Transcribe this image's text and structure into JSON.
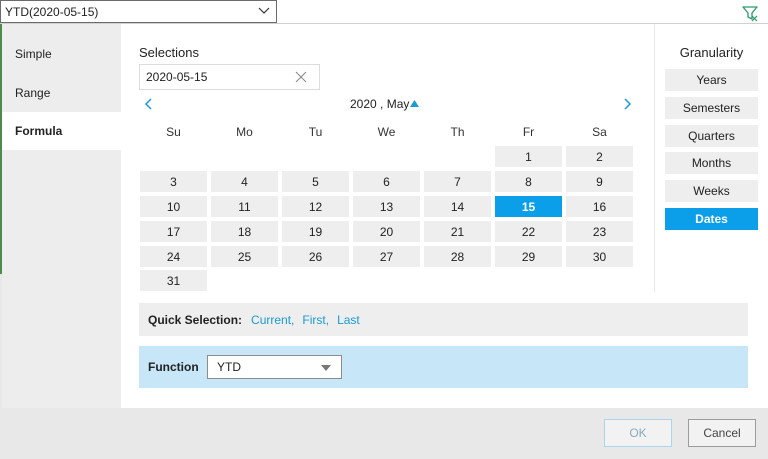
{
  "top_select": {
    "value": "YTD(2020-05-15)"
  },
  "tabs": [
    {
      "label": "Simple"
    },
    {
      "label": "Range"
    },
    {
      "label": "Formula"
    }
  ],
  "selections": {
    "label": "Selections",
    "value": "2020-05-15"
  },
  "calendar": {
    "month_label": "2020 , May",
    "weekdays": [
      "Su",
      "Mo",
      "Tu",
      "We",
      "Th",
      "Fr",
      "Sa"
    ],
    "days": [
      "1",
      "2",
      "3",
      "4",
      "5",
      "6",
      "7",
      "8",
      "9",
      "10",
      "11",
      "12",
      "13",
      "14",
      "15",
      "16",
      "17",
      "18",
      "19",
      "20",
      "21",
      "22",
      "23",
      "24",
      "25",
      "26",
      "27",
      "28",
      "29",
      "30",
      "31"
    ],
    "selected_day": "15",
    "first_weekday_index": 5
  },
  "granularity": {
    "title": "Granularity",
    "options": [
      "Years",
      "Semesters",
      "Quarters",
      "Months",
      "Weeks",
      "Dates"
    ],
    "active": "Dates"
  },
  "quick_selection": {
    "label": "Quick Selection:",
    "links": [
      "Current,",
      "First,",
      "Last"
    ]
  },
  "function": {
    "label": "Function",
    "value": "YTD"
  },
  "buttons": {
    "ok": "OK",
    "cancel": "Cancel"
  },
  "colors": {
    "accent": "#0a9fe8",
    "function_bg": "#c7e6f8",
    "link": "#1a9ad6"
  }
}
